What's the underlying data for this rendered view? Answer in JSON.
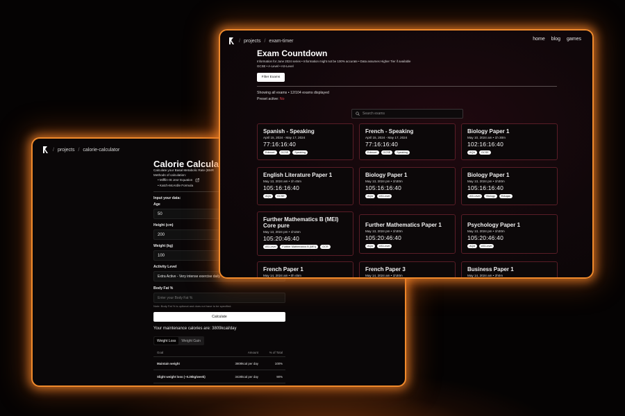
{
  "calorie": {
    "breadcrumb": [
      "projects",
      "calorie-calculator"
    ],
    "title": "Calorie Calculat",
    "subtitle": "Calculate your Basal Metabolic Rate (BMR",
    "methods_label": "Methods of calculation:",
    "methods": [
      "• Mifflin-St Jeor Equation",
      "• Katch-McArdle Formula"
    ],
    "input_label": "Input your data:",
    "age_label": "Age",
    "age_value": "50",
    "height_label": "Height (cm)",
    "height_value": "200",
    "weight_label": "Weight (kg)",
    "weight_value": "100",
    "activity_label": "Activity Level",
    "activity_value": "Extra Active - Very intense exercise daily",
    "bodyfat_label": "Body Fat %",
    "bodyfat_placeholder": "Enter your Body Fat %",
    "bodyfat_note": "Note: Body Fat % is optional and does not have to be specified.",
    "calculate_label": "Calculate",
    "maintenance_text": "Your maintenance calories are: 3809kcal/day",
    "tabs": [
      "Weight Loss",
      "Weight Gain"
    ],
    "table": {
      "headers": [
        "Goal",
        "Amount",
        "% of Total"
      ],
      "rows": [
        [
          "Maintain weight",
          "3809kcal per day",
          "100%"
        ],
        [
          "Slight weight loss (~0.25kg/week)",
          "3428kcal per day",
          "90%"
        ]
      ]
    }
  },
  "exam": {
    "breadcrumb": [
      "projects",
      "exam-timer"
    ],
    "nav_links": [
      "home",
      "blog",
      "games"
    ],
    "title": "Exam Countdown",
    "info_line": "Information for June 2024 series • Information might not be 100% accurate • Data assumes Higher Tier if available",
    "levels_line": "GCSE • A-Level • AS-Level",
    "filter_label": "Filter Exams",
    "showing_text": "Showing all exams • 12/104 exams displayed",
    "preset_label": "Preset active:",
    "preset_value": "No",
    "search_placeholder": "Search exams",
    "cards": [
      {
        "title": "Spanish - Speaking",
        "date": "April 15, 2024 - May 17, 2024",
        "timer": "77:16:16:40",
        "tags": [
          "Edexcel",
          "GCSE",
          "Speaking"
        ]
      },
      {
        "title": "French - Speaking",
        "date": "April 15, 2024 - May 17, 2024",
        "timer": "77:16:16:40",
        "tags": [
          "Edexcel",
          "GCSE",
          "Speaking"
        ]
      },
      {
        "title": "Biology Paper 1",
        "date": "May 10, 2024 am • 1h 30m",
        "timer": "102:16:16:40",
        "tags": [
          "AQA",
          "GCSE"
        ]
      },
      {
        "title": "English Literature Paper 1",
        "date": "May 13, 2024 am • 1h 45m",
        "timer": "105:16:16:40",
        "tags": [
          "AQA",
          "GCSE"
        ]
      },
      {
        "title": "Biology Paper 1",
        "date": "May 13, 2024 pm • 1h30m",
        "timer": "105:16:16:40",
        "tags": [
          "AQA",
          "AS-Level"
        ]
      },
      {
        "title": "Biology Paper 1",
        "date": "May 13, 2024 pm • 1h30m",
        "timer": "105:16:16:40",
        "tags": [
          "AS-Level",
          "Biology",
          "Eduqas"
        ]
      },
      {
        "title": "Further Mathematics B (MEI) Core pure",
        "date": "May 13, 2024 pm • 1h15m",
        "timer": "105:20:46:40",
        "tags": [
          "AS-Level",
          "Further Mathematics B (MEI)",
          "OCR"
        ]
      },
      {
        "title": "Further Mathematics Paper 1",
        "date": "May 13, 2024 pm • 1h30m",
        "timer": "105:20:46:40",
        "tags": [
          "AQA",
          "AS-Level"
        ]
      },
      {
        "title": "Psychology Paper 1",
        "date": "May 13, 2024 pm • 1h30m",
        "timer": "105:20:46:40",
        "tags": [
          "AQA",
          "AS-Level"
        ]
      },
      {
        "title": "French Paper 1",
        "date": "May 14, 2024 am • 0h 45m",
        "timer": "",
        "tags": []
      },
      {
        "title": "French Paper 3",
        "date": "May 14, 2024 am • 1h30m",
        "timer": "",
        "tags": []
      },
      {
        "title": "Business Paper 1",
        "date": "May 14, 2024 am • 2h0m",
        "timer": "",
        "tags": []
      }
    ]
  },
  "colors": {
    "glow": "#f08a2c",
    "card_border": "#5a1d27",
    "preset_no": "#e0434e"
  },
  "icons": [
    "logo-icon",
    "external-link-icon",
    "search-icon"
  ]
}
